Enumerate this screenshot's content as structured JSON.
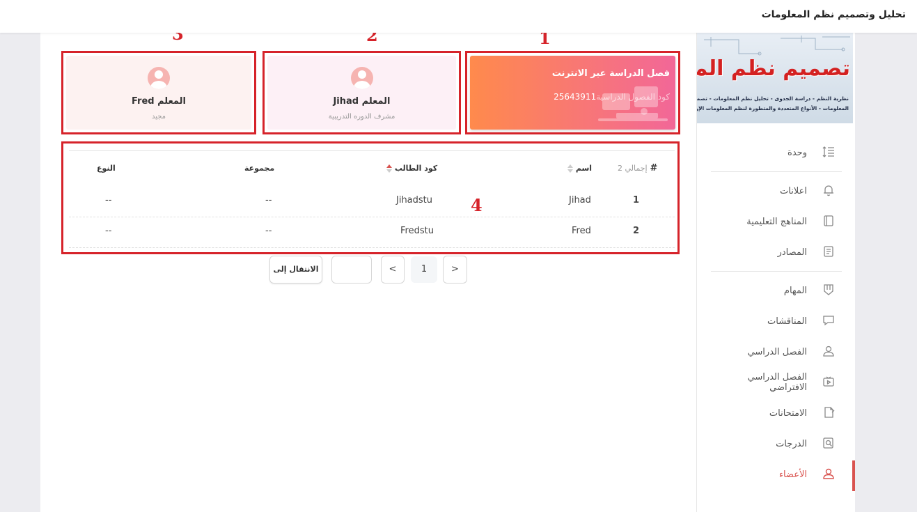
{
  "app": {
    "title": "تحليل وتصميم نظم المعلومات"
  },
  "course_image": {
    "title": "تصميم نظم المعلومات",
    "line1": "نظرية النظم - دراسة الجدوى - تحليل نظم المعلومات - تصميم نظم",
    "line2": "المعلومات - الأنواع المتعددة والمتطورة لنظم المعلومات الإرجونوميكس"
  },
  "sidebar": {
    "items": [
      {
        "label": "وحدة",
        "icon": "list-indent-icon"
      },
      {
        "label": "اعلانات",
        "icon": "bell-icon"
      },
      {
        "label": "المناهج التعليمية",
        "icon": "book-icon"
      },
      {
        "label": "المصادر",
        "icon": "resources-icon"
      },
      {
        "label": "المهام",
        "icon": "shield-task-icon"
      },
      {
        "label": "المناقشات",
        "icon": "chat-icon"
      },
      {
        "label": "الفصل الدراسي",
        "icon": "person-icon"
      },
      {
        "label": "الفصل الدراسي الافتراضي",
        "icon": "video-play-icon"
      },
      {
        "label": "الامتحانات",
        "icon": "exam-icon"
      },
      {
        "label": "الدرجات",
        "icon": "grades-search-icon"
      },
      {
        "label": "الأعضاء",
        "icon": "member-icon",
        "active": true
      }
    ],
    "accent": "#d9534f"
  },
  "cards": {
    "online": {
      "title": "فصل الدراسة عبر الانترنت",
      "code_label": "كود الفصول الدراسية",
      "code": "25643911",
      "gradient": [
        "#ff8a4c",
        "#f26798"
      ]
    },
    "teacher1": {
      "name": "Jihad المعلم",
      "role": "مشرف الدوره التدريبية"
    },
    "teacher2": {
      "name": "Fred المعلم",
      "role": "مجيد"
    }
  },
  "annotations": [
    "1",
    "2",
    "3",
    "4"
  ],
  "table": {
    "headers": {
      "num": "#",
      "total": "إجمالي 2",
      "name": "اسم",
      "code": "كود الطالب",
      "group": "مجموعة",
      "type": "النوع"
    },
    "rows": [
      {
        "num": "1",
        "name": "Jihad",
        "code": "Jihadstu",
        "group": "--",
        "type": "--"
      },
      {
        "num": "2",
        "name": "Fred",
        "code": "Fredstu",
        "group": "--",
        "type": "--"
      }
    ]
  },
  "pagination": {
    "prev": "<",
    "current": "1",
    "next": ">",
    "goto_value": "",
    "goto_label": "الانتقال إلى"
  },
  "colors": {
    "annotation_red": "#d6232a"
  }
}
